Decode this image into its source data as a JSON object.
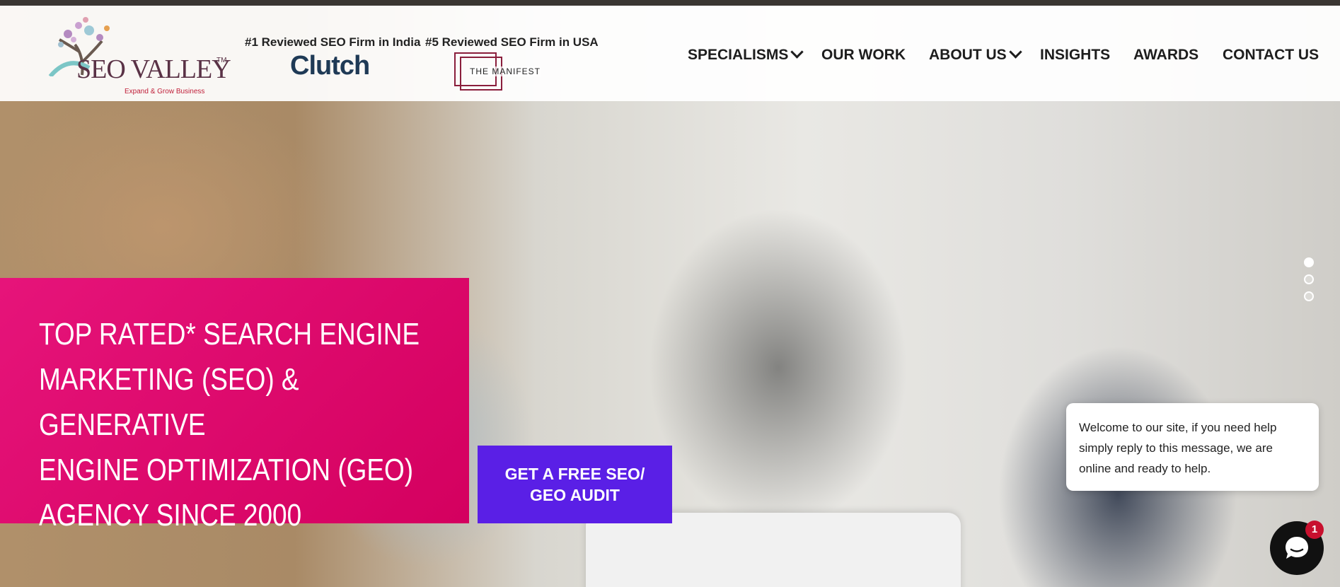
{
  "header": {
    "logo": {
      "brand": "SEO VALLEY",
      "tm": "TM",
      "tagline": "Expand & Grow Business"
    },
    "badges": [
      {
        "text": "#1 Reviewed SEO Firm in India",
        "logo_text": "Clutch"
      },
      {
        "text": "#5 Reviewed SEO Firm in USA",
        "logo_text": "THE MANIFEST"
      }
    ],
    "nav": [
      {
        "label": "SPECIALISMS",
        "has_dropdown": true
      },
      {
        "label": "OUR WORK",
        "has_dropdown": false
      },
      {
        "label": "ABOUT US",
        "has_dropdown": true
      },
      {
        "label": "INSIGHTS",
        "has_dropdown": false
      },
      {
        "label": "AWARDS",
        "has_dropdown": false
      },
      {
        "label": "CONTACT US",
        "has_dropdown": false
      }
    ]
  },
  "hero": {
    "headline": "TOP RATED* SEARCH ENGINE MARKETING (SEO) & GENERATIVE ENGINE OPTIMIZATION (GEO) AGENCY SINCE 2000",
    "headline_lines": [
      "TOP RATED* SEARCH ENGINE",
      "MARKETING (SEO) & GENERATIVE",
      "ENGINE OPTIMIZATION (GEO)",
      "AGENCY SINCE 2000"
    ],
    "cta_lines": [
      "GET A FREE SEO/",
      "GEO AUDIT"
    ],
    "slider": {
      "count": 3,
      "active": 1
    }
  },
  "chat": {
    "message": "Welcome to our site, if you need help simply reply to this message, we are online and ready to help.",
    "unread_count": "1"
  },
  "colors": {
    "panel": "#e0106e",
    "cta": "#5a1fe6",
    "nav_text": "#1d1d1d",
    "brand": "#5a3246"
  },
  "icons": {
    "nav_dropdown": "chevron-down-icon",
    "chat": "chat-bubble-icon"
  }
}
